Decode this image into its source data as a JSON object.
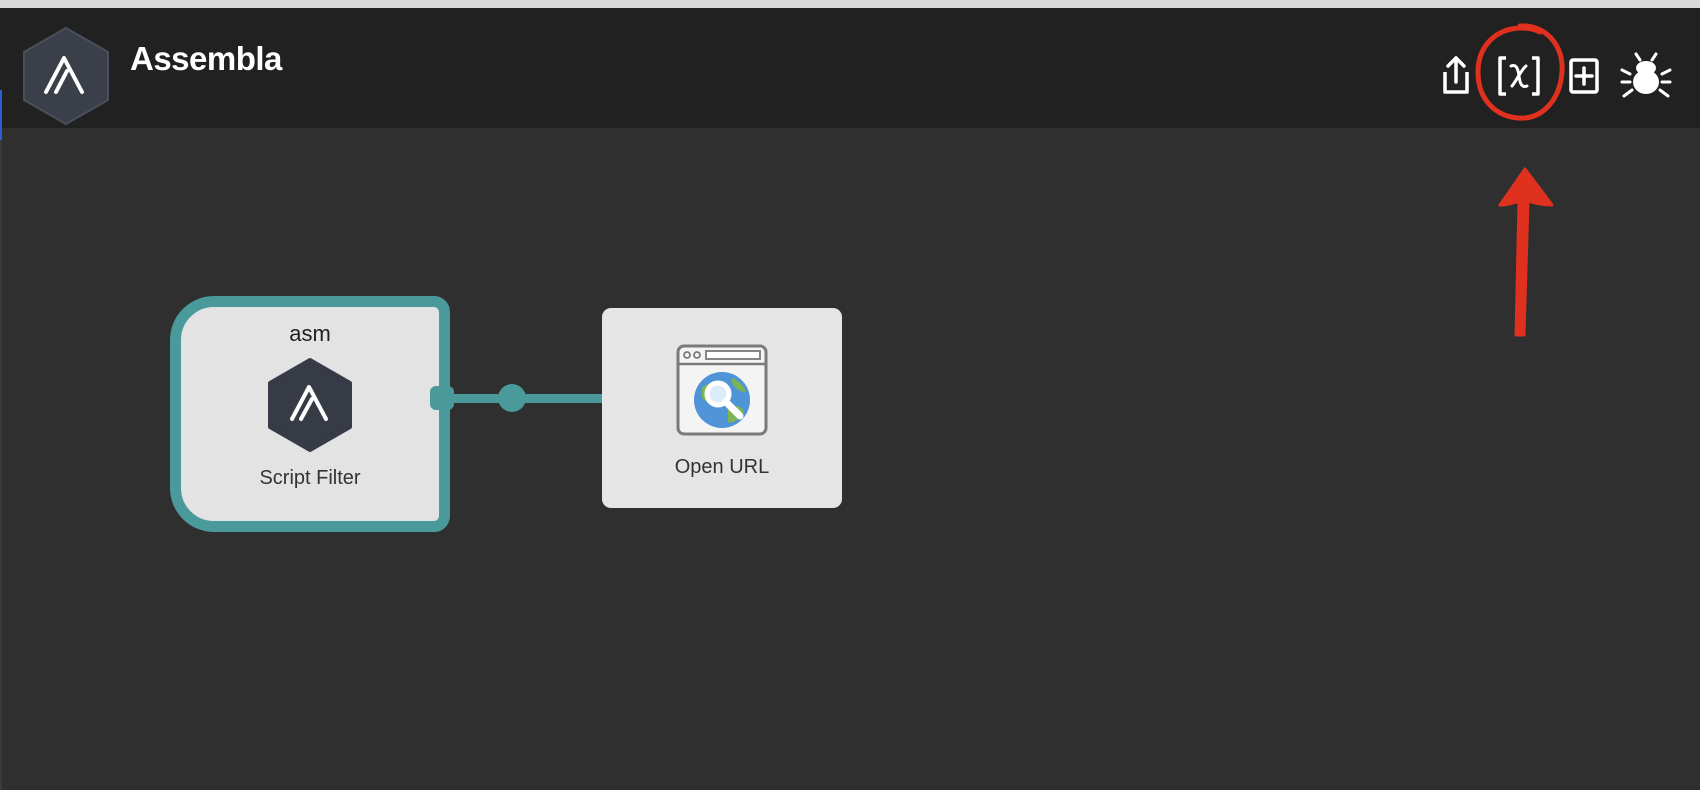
{
  "header": {
    "title": "Assembla",
    "logo_icon": "assembla-logo-icon"
  },
  "toolbar": {
    "share_icon": "share-export-icon",
    "variables_icon": "variables-bracket-x-icon",
    "add_icon": "add-plus-box-icon",
    "debug_icon": "debug-bug-icon"
  },
  "annotation": {
    "color": "#e0301e",
    "target": "variables-button"
  },
  "canvas": {
    "nodes": [
      {
        "type": "Script Filter",
        "keyword": "asm",
        "label": "Script Filter",
        "icon": "assembla-logo-icon",
        "border_color": "#4a9a9c"
      },
      {
        "type": "Open URL",
        "label": "Open URL",
        "icon": "browser-globe-search-icon"
      }
    ],
    "connection_color": "#4a9a9c"
  },
  "colors": {
    "header_bg": "#212121",
    "canvas_bg": "#2f2f2f",
    "node_bg": "#e5e5e5",
    "accent_teal": "#4a9a9c"
  }
}
